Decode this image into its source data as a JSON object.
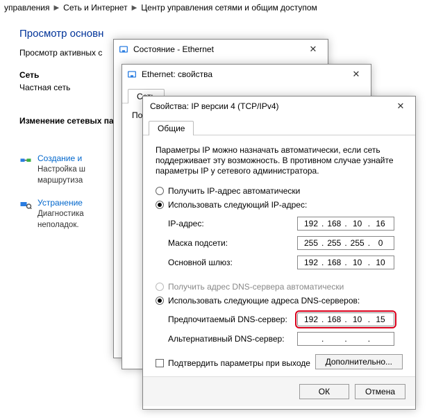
{
  "breadcrumb": {
    "a": "управления",
    "b": "Сеть и Интернет",
    "c": "Центр управления сетями и общим доступом"
  },
  "page": {
    "title": "Просмотр основн",
    "sub": "Просмотр активных с",
    "h1": "Сеть",
    "l1": "Частная сеть",
    "h2": "Изменение сетевых па",
    "task1_title": "Создание и",
    "task1_desc1": "Настройка ш",
    "task1_desc2": "маршрутиза",
    "task2_title": "Устранение",
    "task2_desc1": "Диагностика",
    "task2_desc2": "неполадок."
  },
  "win_status": {
    "title": "Состояние - Ethernet"
  },
  "win_props": {
    "title": "Ethernet: свойства",
    "tab": "Сеть",
    "sub": "По"
  },
  "ipv4": {
    "title": "Свойства: IP версии 4 (TCP/IPv4)",
    "tab": "Общие",
    "intro": "Параметры IP можно назначать автоматически, если сеть поддерживает эту возможность. В противном случае узнайте параметры IP у сетевого администратора.",
    "r_ip_auto": "Получить IP-адрес автоматически",
    "r_ip_man": "Использовать следующий IP-адрес:",
    "lbl_ip": "IP-адрес:",
    "lbl_mask": "Маска подсети:",
    "lbl_gw": "Основной шлюз:",
    "val_ip": [
      "192",
      "168",
      "10",
      "16"
    ],
    "val_mask": [
      "255",
      "255",
      "255",
      "0"
    ],
    "val_gw": [
      "192",
      "168",
      "10",
      "10"
    ],
    "r_dns_auto": "Получить адрес DNS-сервера автоматически",
    "r_dns_man": "Использовать следующие адреса DNS-серверов:",
    "lbl_dns1": "Предпочитаемый DNS-сервер:",
    "lbl_dns2": "Альтернативный DNS-сервер:",
    "val_dns1": [
      "192",
      "168",
      "10",
      "15"
    ],
    "val_dns2": [
      "",
      "",
      "",
      ""
    ],
    "cb_validate": "Подтвердить параметры при выходе",
    "btn_adv": "Дополнительно...",
    "btn_ok": "ОК",
    "btn_cancel": "Отмена"
  }
}
